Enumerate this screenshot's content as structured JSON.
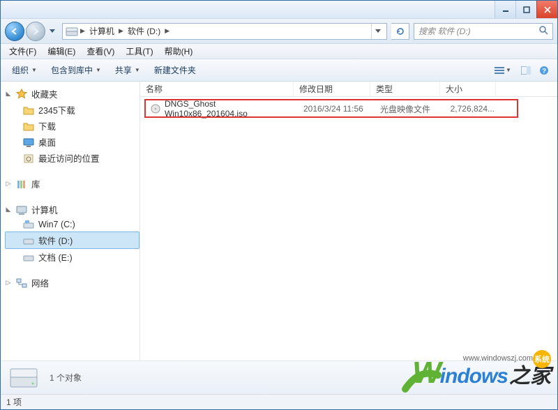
{
  "titlebar": {},
  "address": {
    "crumb1": "计算机",
    "crumb2": "软件 (D:)"
  },
  "search": {
    "placeholder": "搜索 软件 (D:)"
  },
  "menu": {
    "file": "文件(F)",
    "edit": "编辑(E)",
    "view": "查看(V)",
    "tools": "工具(T)",
    "help": "帮助(H)"
  },
  "toolbar": {
    "organize": "组织",
    "include": "包含到库中",
    "share": "共享",
    "newfolder": "新建文件夹"
  },
  "nav": {
    "favorites": "收藏夹",
    "dl2345": "2345下载",
    "downloads": "下载",
    "desktop": "桌面",
    "recent": "最近访问的位置",
    "libraries": "库",
    "computer": "计算机",
    "win7c": "Win7 (C:)",
    "softd": "软件 (D:)",
    "doce": "文档 (E:)",
    "network": "网络"
  },
  "columns": {
    "name": "名称",
    "date": "修改日期",
    "type": "类型",
    "size": "大小"
  },
  "files": [
    {
      "name": "DNGS_Ghost Win10x86_201604.iso",
      "date": "2016/3/24 11:56",
      "type": "光盘映像文件",
      "size": "2,726,824..."
    }
  ],
  "details": {
    "objects": "1 个对象"
  },
  "status": {
    "items": "1 项"
  },
  "watermark": {
    "url": "www.windowszj.com",
    "badge": "系统",
    "w": "W",
    "rest": "indows",
    "cn": "之家"
  }
}
